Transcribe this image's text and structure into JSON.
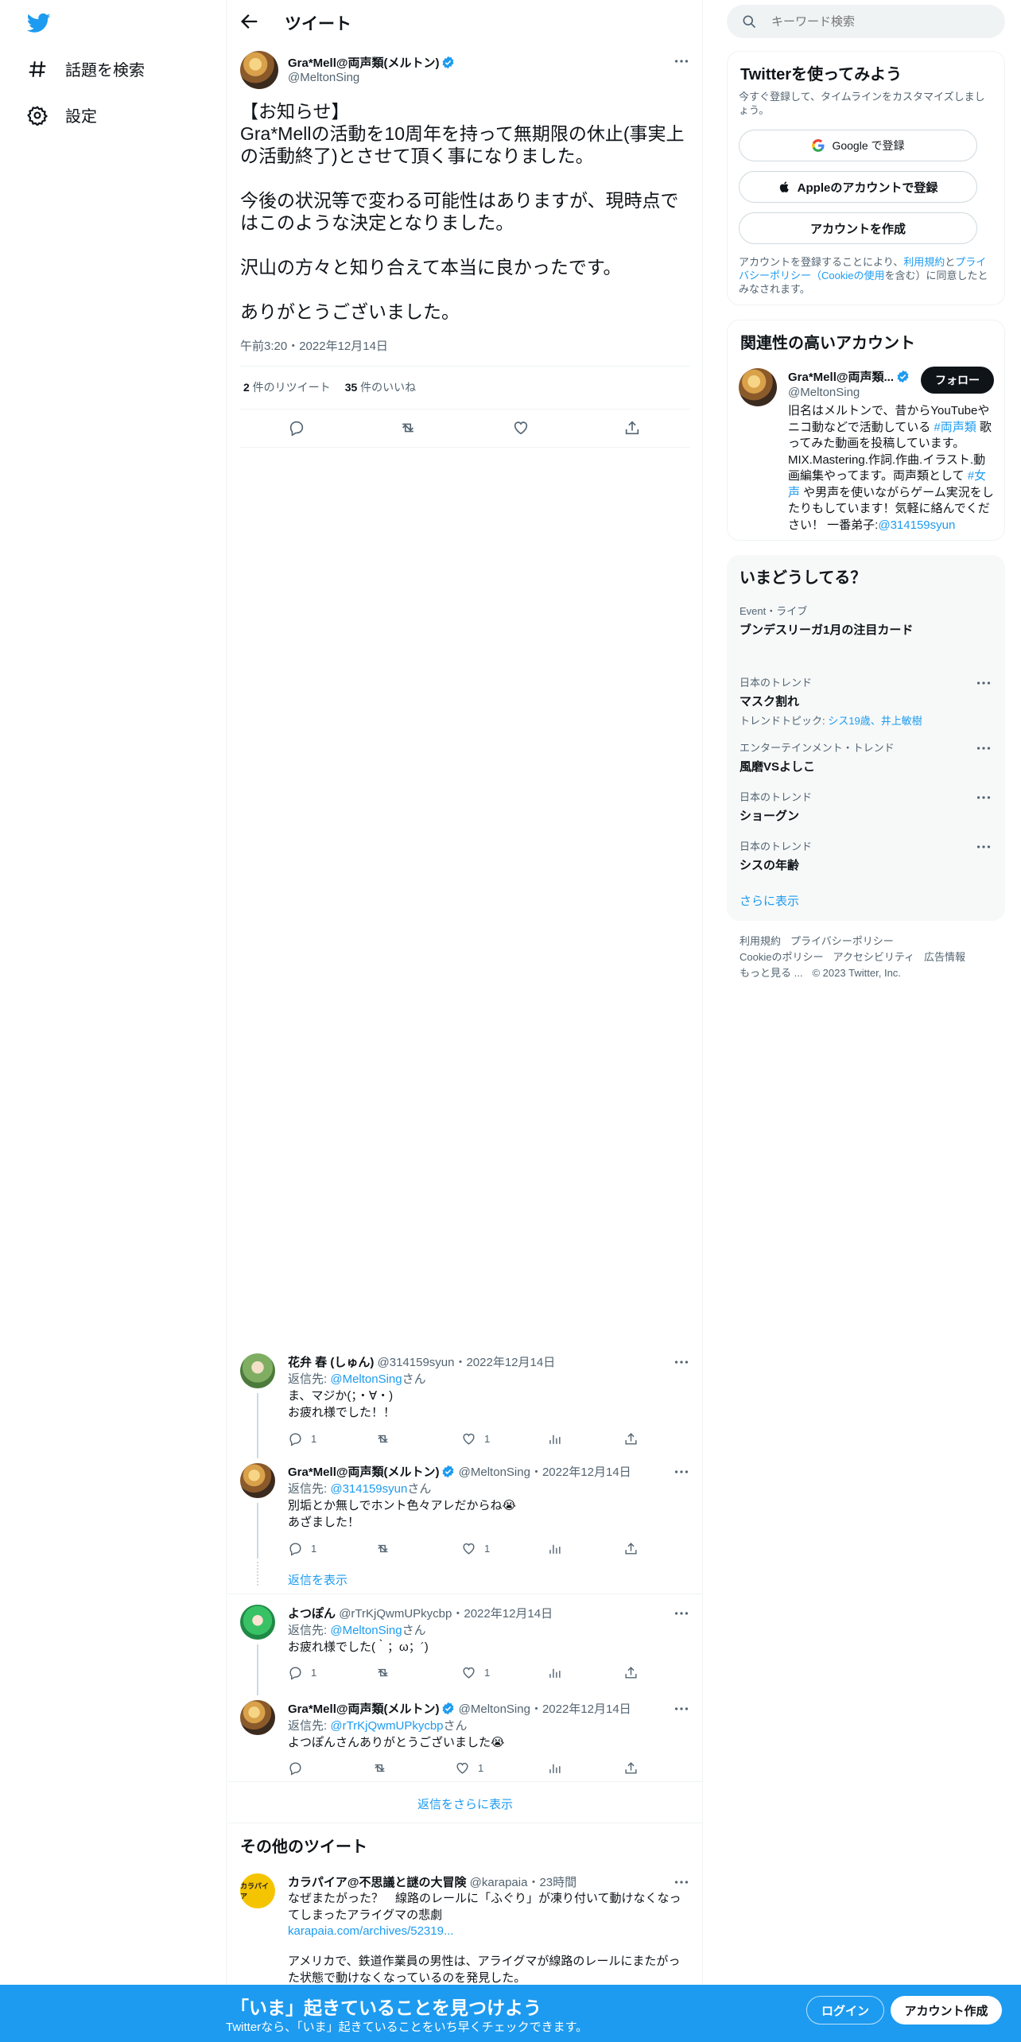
{
  "nav": {
    "explore_label": "話題を検索",
    "settings_label": "設定"
  },
  "header": {
    "title": "ツイート"
  },
  "main_tweet": {
    "name": "Gra*Mell@両声類(メルトン)",
    "handle": "@MeltonSing",
    "text": "【お知らせ】\nGra*Mellの活動を10周年を持って無期限の休止(事実上の活動終了)とさせて頂く事になりました。\n\n今後の状況等で変わる可能性はありますが、現時点ではこのような決定となりました。\n\n沢山の方々と知り合えて本当に良かったです。\n\nありがとうございました。",
    "time": "午前3:20・2022年12月14日",
    "retweets": "2",
    "retweets_label": " 件のリツイート",
    "likes": "35",
    "likes_label": " 件のいいね"
  },
  "replies": [
    {
      "name": "花弁 春 (しゅん)",
      "handle": "@314159syun",
      "date": "・2022年12月14日",
      "reply_prefix": "返信先: ",
      "reply_to": "@MeltonSing",
      "reply_suffix": "さん",
      "text": "ま、マジか(；・∀・)\nお疲れ様でした！！",
      "replies": "1",
      "retweets": "",
      "likes": "1"
    },
    {
      "name": "Gra*Mell@両声類(メルトン)",
      "handle": "@MeltonSing",
      "date": "・2022年12月14日",
      "reply_prefix": "返信先: ",
      "reply_to": "@314159syun",
      "reply_suffix": "さん",
      "text": "別垢とか無しでホント色々アレだからね😭\nあざました！",
      "replies": "1",
      "retweets": "",
      "likes": "1",
      "show_replies": "返信を表示"
    },
    {
      "name": "よつぽん",
      "handle": "@rTrKjQwmUPkycbp",
      "date": "・2022年12月14日",
      "reply_prefix": "返信先: ",
      "reply_to": "@MeltonSing",
      "reply_suffix": "さん",
      "text": "お疲れ様でした(｀；ω；´)",
      "replies": "1",
      "retweets": "",
      "likes": "1"
    },
    {
      "name": "Gra*Mell@両声類(メルトン)",
      "handle": "@MeltonSing",
      "date": "・2022年12月14日",
      "reply_prefix": "返信先: ",
      "reply_to": "@rTrKjQwmUPkycbp",
      "reply_suffix": "さん",
      "text": "よつぽんさんありがとうございました😭",
      "replies": "",
      "retweets": "",
      "likes": "1"
    }
  ],
  "show_more_replies": "返信をさらに表示",
  "more_tweets": {
    "title": "その他のツイート",
    "avatar_text": "カラパイア",
    "name": "カラパイア@不思議と謎の大冒険",
    "handle": "@karapaia",
    "time": "・23時間",
    "text": "なぜまたがった？　線路のレールに「ふぐり」が凍り付いて動けなくなってしまったアライグマの悲劇",
    "link": "karapaia.com/archives/52319...",
    "text2": "アメリカで、鉄道作業員の男性は、アライグマが線路のレールにまたがった状態で動けなくなっているのを発見した。"
  },
  "search": {
    "placeholder": "キーワード検索"
  },
  "signup_card": {
    "title": "Twitterを使ってみよう",
    "subtitle": "今すぐ登録して、タイムラインをカスタマイズしましょう。",
    "google": "Google で登録",
    "apple": "Appleのアカウントで登録",
    "create": "アカウントを作成",
    "legal_1": "アカウントを登録することにより、",
    "legal_terms": "利用規約",
    "legal_and": "と",
    "legal_privacy": "プライバシーポリシー",
    "legal_open": "（",
    "legal_cookie": "Cookieの使用",
    "legal_2": "を含む）に同意したとみなされます。"
  },
  "related": {
    "title": "関連性の高いアカウント",
    "name": "Gra*Mell@両声類...",
    "handle": "@MeltonSing",
    "follow": "フォロー",
    "bio_1": "旧名はメルトンで、昔からYouTubeやニコ動などで活動している ",
    "bio_tag1": "#両声類",
    "bio_2": " 歌ってみた動画を投稿しています。MIX.Mastering.作詞.作曲.イラスト.動画編集やってます。両声類として ",
    "bio_tag2": "#女声",
    "bio_3": " や男声を使いながらゲーム実況をしたりもしています！気軽に絡んでください！ 一番弟子:",
    "bio_mention": "@314159syun"
  },
  "trends": {
    "title": "いまどうしてる？",
    "items": [
      {
        "category": "Event・ライブ",
        "name": "ブンデスリーガ1月の注目カード",
        "more": false
      },
      {
        "category": "日本のトレンド",
        "name": "マスク割れ",
        "topic_label": "トレンドトピック: ",
        "topic": "シス19歳、井上敏樹",
        "more": true
      },
      {
        "category": "エンターテインメント・トレンド",
        "name": "風磨VSよしこ",
        "more": true
      },
      {
        "category": "日本のトレンド",
        "name": "ショーグン",
        "more": true
      },
      {
        "category": "日本のトレンド",
        "name": "シスの年齢",
        "more": true
      }
    ],
    "show_more": "さらに表示"
  },
  "footer": {
    "terms": "利用規約",
    "privacy": "プライバシーポリシー",
    "cookie": "Cookieのポリシー",
    "accessibility": "アクセシビリティ",
    "ads": "広告情報",
    "more": "もっと見る ...",
    "copyright": "© 2023 Twitter, Inc."
  },
  "banner": {
    "title": "「いま」起きていることを見つけよう",
    "subtitle": "Twitterなら、「いま」起きていることをいち早くチェックできます。",
    "login": "ログイン",
    "signup": "アカウント作成"
  },
  "colors": {
    "accent": "#1d9bf0",
    "text": "#0f1419",
    "muted": "#536471"
  }
}
